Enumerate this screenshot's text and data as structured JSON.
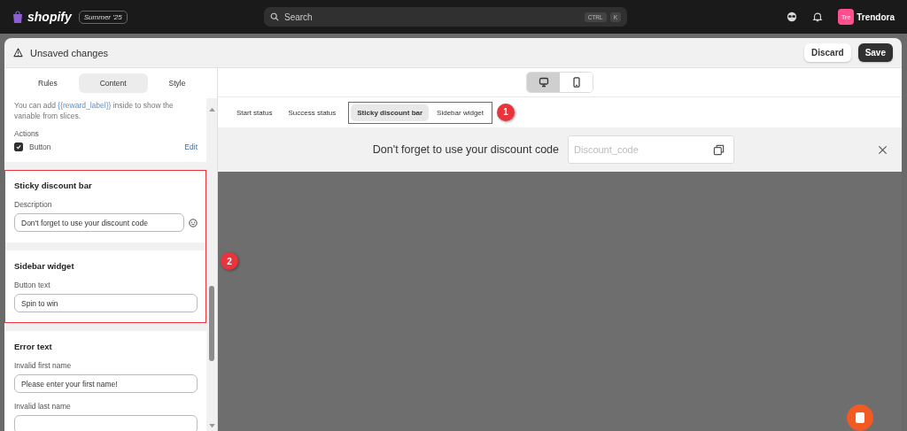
{
  "top_bar": {
    "brand": "shopify",
    "edition": "Summer '25",
    "search": {
      "placeholder": "Search",
      "shortcut": [
        "CTRL",
        "K"
      ]
    },
    "avatar_initials": "Tre",
    "store_name": "Trendora"
  },
  "modal": {
    "title": "Unsaved changes",
    "buttons": [
      {
        "label": "Discard",
        "kind": "secondary"
      },
      {
        "label": "Save",
        "kind": "primary"
      }
    ]
  },
  "editor_tabs": [
    {
      "label": "Rules",
      "selected": false
    },
    {
      "label": "Content",
      "selected": true
    },
    {
      "label": "Style",
      "selected": false
    }
  ],
  "settings": {
    "intro": [
      {
        "text": "You can add ",
        "kind": "plain"
      },
      {
        "text": "{{reward_label}}",
        "kind": "variable"
      },
      {
        "text": " inside to show the variable from slices.",
        "kind": "plain"
      }
    ],
    "actions_label": "Actions",
    "actions": [
      {
        "label": "Button",
        "checked": true,
        "link": "Edit"
      }
    ],
    "callout": "2",
    "sections": [
      {
        "title": "Sticky discount bar",
        "highlighted": true,
        "fields": [
          {
            "label": "Description",
            "value": "Don't forget to use your discount code",
            "emoji_picker": true
          }
        ]
      },
      {
        "title": "Sidebar widget",
        "highlighted": true,
        "fields": [
          {
            "label": "Button text",
            "value": "Spin to win",
            "emoji_picker": false
          }
        ]
      },
      {
        "title": "Error text",
        "highlighted": false,
        "fields": [
          {
            "label": "Invalid first name",
            "value": "Please enter your first name!",
            "emoji_picker": false
          },
          {
            "label": "Invalid last name",
            "emoji_picker": false
          }
        ]
      }
    ]
  },
  "preview": {
    "devices": [
      {
        "kind": "desktop",
        "selected": true
      },
      {
        "kind": "mobile",
        "selected": false
      }
    ],
    "callout": "1",
    "tabs": [
      {
        "label": "Start status",
        "selected": false,
        "highlighted": false
      },
      {
        "label": "Success status",
        "selected": false,
        "highlighted": false
      },
      {
        "label": "Sticky discount bar",
        "selected": true,
        "highlighted": true
      },
      {
        "label": "Sidebar widget",
        "selected": false,
        "highlighted": true
      }
    ],
    "bar": {
      "message": "Don't forget to use your discount code",
      "code_placeholder": "Discount_code"
    }
  }
}
